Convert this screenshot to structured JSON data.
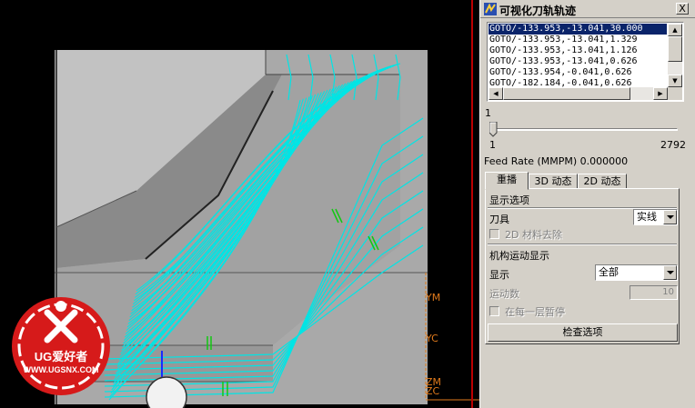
{
  "dialog": {
    "title": "可视化刀轨轨迹",
    "close_label": "X",
    "gcode_lines": [
      "GOTO/-133.953,-13.041,30.000",
      "GOTO/-133.953,-13.041,1.329",
      "GOTO/-133.953,-13.041,1.126",
      "GOTO/-133.953,-13.041,0.626",
      "GOTO/-133.954,-0.041,0.626",
      "GOTO/-182.184,-0.041,0.626"
    ],
    "selected_line_index": 0,
    "slider": {
      "current": "1",
      "min": "1",
      "max": "2792",
      "position_fraction": 0
    },
    "feed_rate": "Feed Rate (MMPM) 0.000000",
    "tabs": [
      {
        "label": "重播",
        "active": true
      },
      {
        "label": "3D 动态",
        "active": false
      },
      {
        "label": "2D 动态",
        "active": false
      }
    ],
    "display_options": {
      "section_label": "显示选项",
      "tool_label": "刀具",
      "tool_value": "实线",
      "material_removal_label": "2D 材料去除",
      "material_removal_checked": false
    },
    "mechanism": {
      "section_label": "机构运动显示",
      "display_label": "显示",
      "display_value": "全部",
      "motion_count_label": "运动数",
      "motion_count_value": "10",
      "pause_label": "在每一层暂停",
      "pause_checked": false
    },
    "check_options_button": "检查选项"
  },
  "viewport": {
    "axis_labels": {
      "ym": "YM",
      "yc": "YC",
      "zm": "ZM",
      "zc": "ZC"
    },
    "logo": {
      "name": "UG爱好者",
      "url": "WWW.UGSNX.COM"
    },
    "colors": {
      "toolpath": "#00e5e5",
      "part": "#a6a6a6",
      "axis": "#e07a1c",
      "background": "#000000"
    }
  }
}
